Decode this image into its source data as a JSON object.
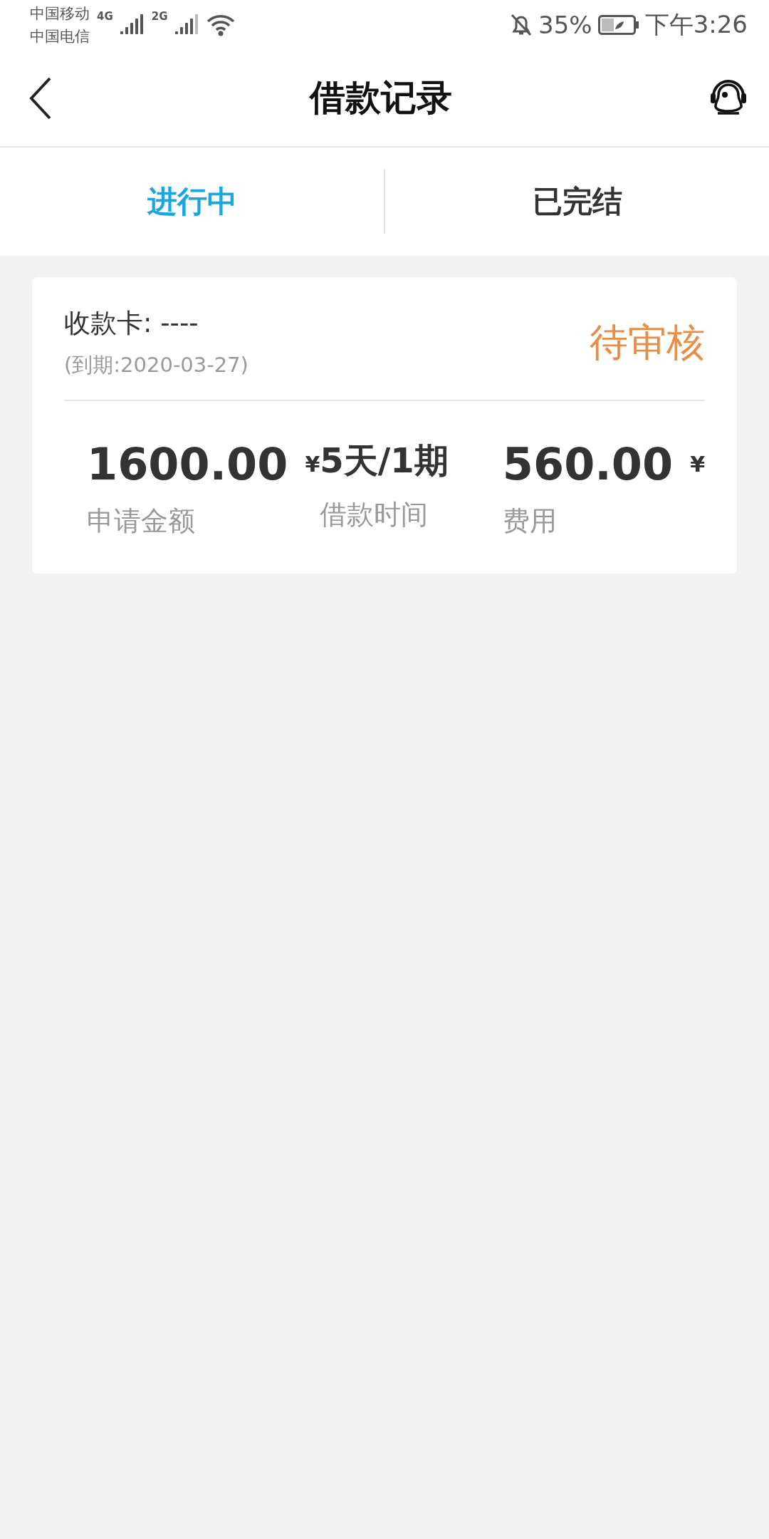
{
  "status_bar": {
    "carriers": [
      "中国移动",
      "中国电信"
    ],
    "network_1": "4G",
    "network_2": "2G",
    "battery": "35%",
    "time": "下午3:26"
  },
  "header": {
    "title": "借款记录"
  },
  "tabs": [
    {
      "label": "进行中",
      "selected": true
    },
    {
      "label": "已完结",
      "selected": false
    }
  ],
  "loans": [
    {
      "card": "收款卡: ----",
      "due": "(到期:2020-03-27)",
      "status": "待审核",
      "stats": [
        {
          "value": "1600.00",
          "unit": "¥",
          "label": "申请金额"
        },
        {
          "value": "5天/1期",
          "label": "借款时间"
        },
        {
          "value": "560.00",
          "unit": "¥",
          "label": "费用"
        }
      ]
    }
  ]
}
